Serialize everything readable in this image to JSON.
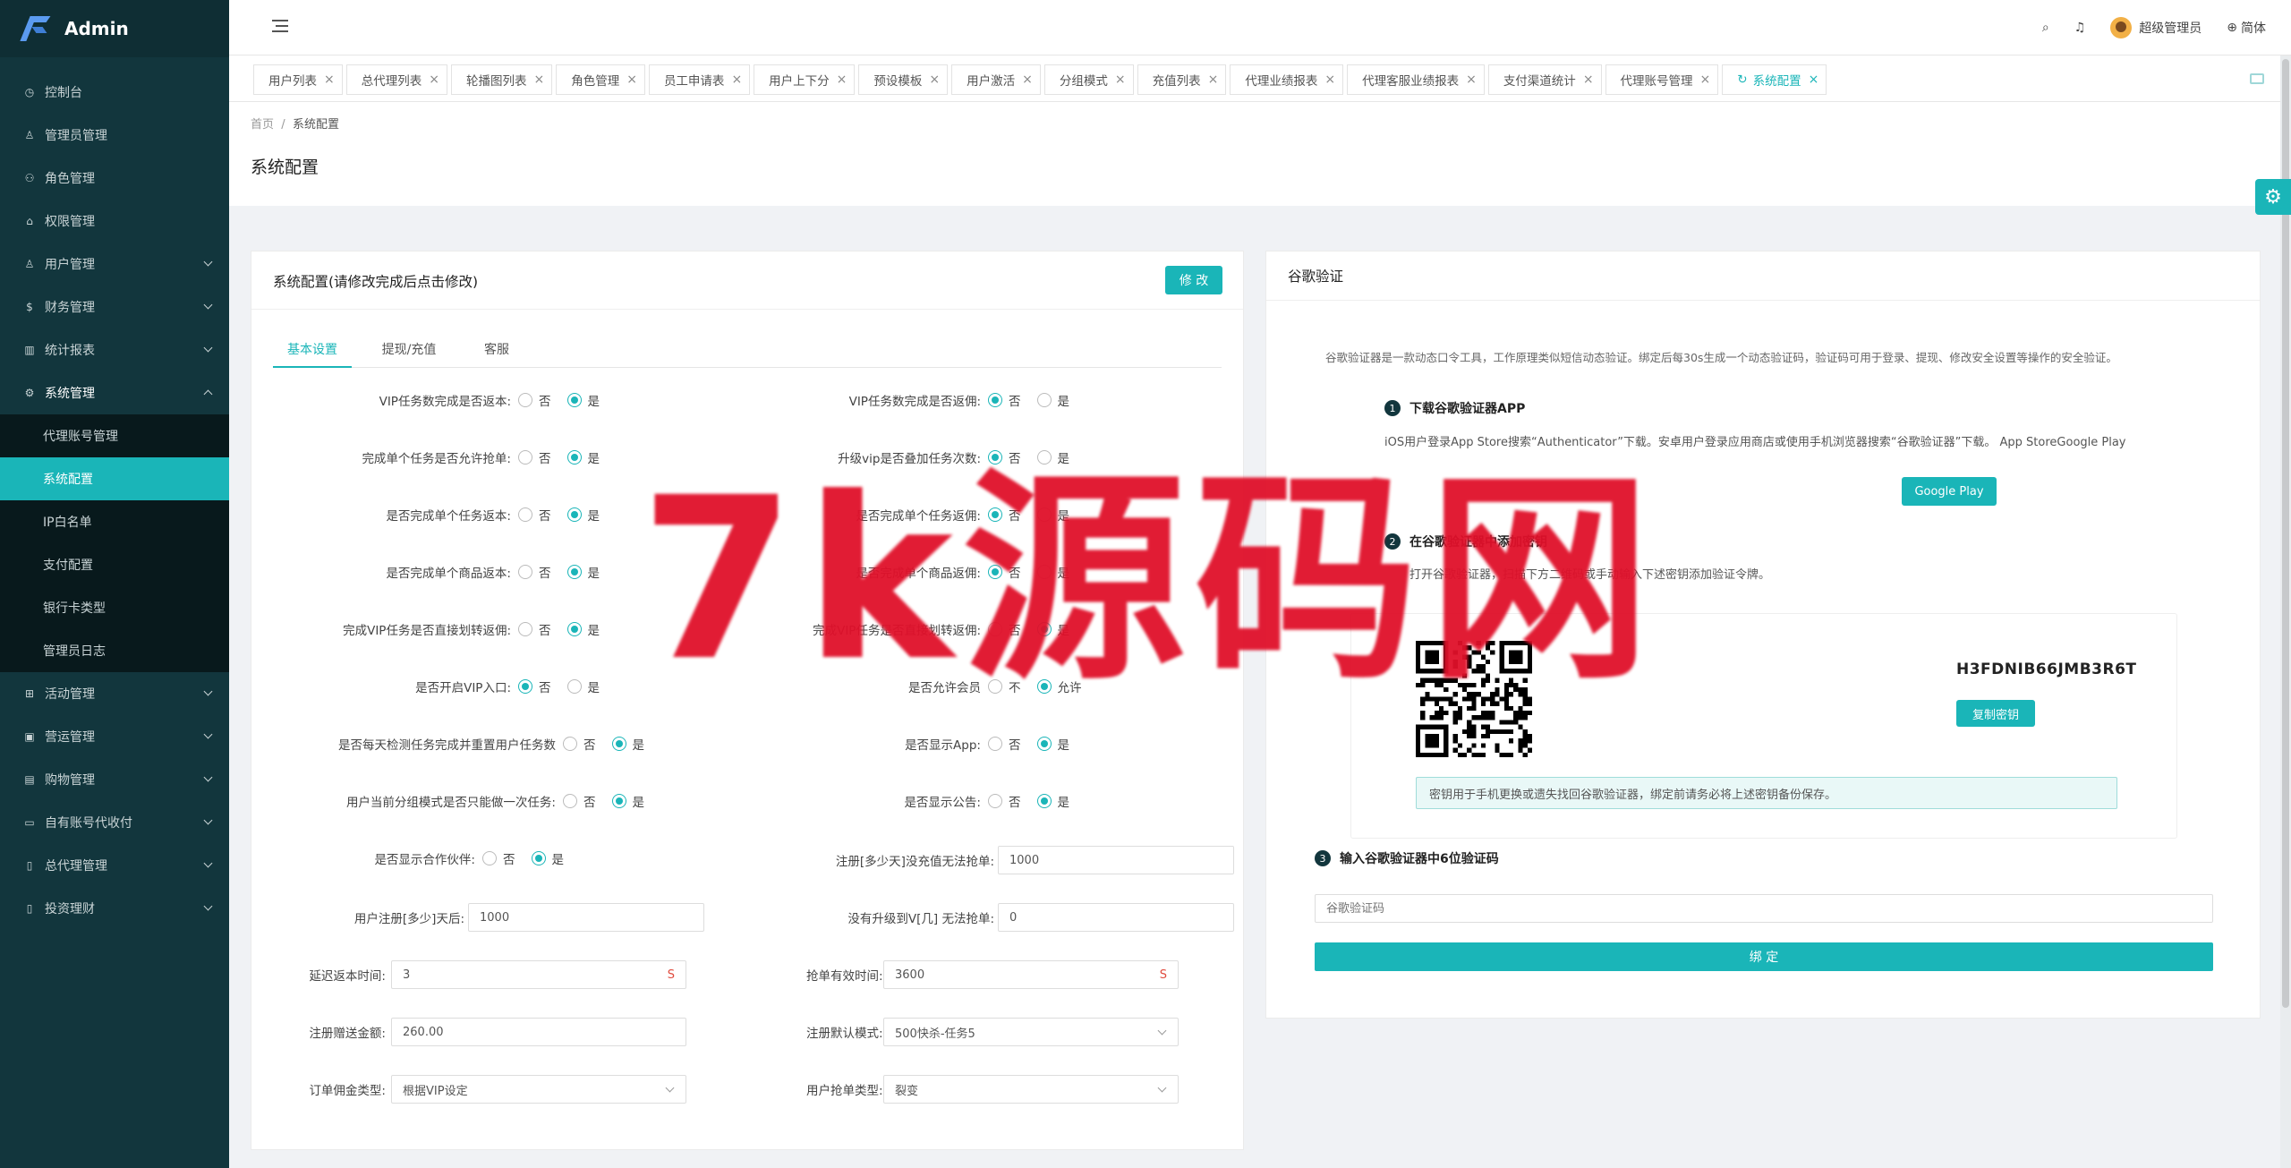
{
  "app": {
    "title": "Admin",
    "accent": "#1ab5b8",
    "sidebar_bg": "#12363d"
  },
  "sidebar": {
    "items": [
      {
        "label": "控制台",
        "icon": "clock-icon"
      },
      {
        "label": "管理员管理",
        "icon": "user-icon"
      },
      {
        "label": "角色管理",
        "icon": "users-icon"
      },
      {
        "label": "权限管理",
        "icon": "bank-icon"
      },
      {
        "label": "用户管理",
        "icon": "user-icon"
      },
      {
        "label": "财务管理",
        "icon": "money-icon"
      },
      {
        "label": "统计报表",
        "icon": "chart-icon"
      },
      {
        "label": "系统管理",
        "icon": "gear-icon"
      },
      {
        "label": "活动管理",
        "icon": "gift-icon"
      },
      {
        "label": "营运管理",
        "icon": "briefcase-icon"
      },
      {
        "label": "购物管理",
        "icon": "cart-icon"
      },
      {
        "label": "自有账号代收付",
        "icon": "card-icon"
      },
      {
        "label": "总代理管理",
        "icon": "doc-icon"
      },
      {
        "label": "投资理财",
        "icon": "doc-icon"
      }
    ],
    "system_sub": [
      "代理账号管理",
      "系统配置",
      "IP白名单",
      "支付配置",
      "银行卡类型",
      "管理员日志"
    ]
  },
  "topbar": {
    "user": "超级管理员",
    "lang": "简体"
  },
  "tabs": [
    "用户列表",
    "总代理列表",
    "轮播图列表",
    "角色管理",
    "员工申请表",
    "用户上下分",
    "预设模板",
    "用户激活",
    "分组模式",
    "充值列表",
    "代理业绩报表",
    "代理客服业绩报表",
    "支付渠道统计",
    "代理账号管理",
    "系统配置"
  ],
  "page": {
    "breadcrumb_home": "首页",
    "breadcrumb_sep": "/",
    "breadcrumb_current": "系统配置",
    "title": "系统配置"
  },
  "config": {
    "title": "系统配置(请修改完成后点击修改)",
    "edit": "修 改",
    "tabs": [
      "基本设置",
      "提现/充值",
      "客服"
    ],
    "no": "否",
    "yes": "是",
    "rows": [
      {
        "label": "VIP任务数完成是否返本:",
        "on": "yes"
      },
      {
        "label": "VIP任务数完成是否返佣:",
        "on": "no"
      },
      {
        "label": "完成单个任务是否允许抢单:",
        "on": "yes"
      },
      {
        "label": "升级vip是否叠加任务次数:",
        "on": "no"
      },
      {
        "label": "是否完成单个任务返本:",
        "on": "yes"
      },
      {
        "label": "是否完成单个任务返佣:",
        "on": "no"
      },
      {
        "label": "是否完成单个商品返本:",
        "on": "yes"
      },
      {
        "label": "是否完成单个商品返佣:",
        "on": "no"
      },
      {
        "label": "完成VIP任务是否直接划转返佣:",
        "on": "yes"
      },
      {
        "label": "完成VIP任务是否直接划转返佣:",
        "on": "yes"
      },
      {
        "label": "是否开启VIP入口:",
        "on": "no"
      },
      {
        "label": "是否允许会员",
        "on": "yes",
        "no_alt": "不",
        "yes_alt": "允许"
      },
      {
        "label": "是否每天检测任务完成并重置用户任务数",
        "on": "yes"
      },
      {
        "label": "是否显示App:",
        "on": "yes"
      },
      {
        "label": "用户当前分组模式是否只能做一次任务:",
        "on": "yes"
      },
      {
        "label": "是否显示公告:",
        "on": "yes"
      },
      {
        "label": "是否显示合作伙伴:",
        "on": "yes"
      }
    ],
    "register_days_label": "注册[多少天]没充值无法抢单:",
    "register_days": "1000",
    "user_register_label": "用户注册[多少]天后:",
    "user_register": "1000",
    "no_upgrade_label": "没有升级到V[几] 无法抢单:",
    "no_upgrade": "0",
    "delay_label": "延迟返本时间:",
    "delay": "3",
    "delay_suffix": "S",
    "grab_label": "抢单有效时间:",
    "grab": "3600",
    "grab_suffix": "S",
    "gift_label": "注册赠送金额:",
    "gift": "260.00",
    "default_mode_label": "注册默认模式:",
    "default_mode": "500快杀-任务5",
    "commission_label": "订单佣金类型:",
    "commission": "根据VIP设定",
    "grab_type_label": "用户抢单类型:",
    "grab_type": "裂变"
  },
  "google": {
    "title": "谷歌验证",
    "desc": "谷歌验证器是一款动态口令工具，工作原理类似短信动态验证。绑定后每30s生成一个动态验证码，验证码可用于登录、提现、修改安全设置等操作的安全验证。",
    "step1": "下载谷歌验证器APP",
    "step1_text": "iOS用户登录App Store搜索“Authenticator”下载。安卓用户登录应用商店或使用手机浏览器搜索“谷歌验证器”下载。 App StoreGoogle Play",
    "google_play": "Google Play",
    "step2": "在谷歌验证器中添加密钥",
    "step2_text": "打开谷歌验证器，扫描下方二维码或手动输入下述密钥添加验证令牌。",
    "secret": "H3FDNIB66JMB3R6T",
    "copy": "复制密钥",
    "tip": "密钥用于手机更换或遗失找回谷歌验证器，绑定前请务必将上述密钥备份保存。",
    "step3": "输入谷歌验证器中6位验证码",
    "placeholder": "谷歌验证码",
    "bind": "绑 定"
  },
  "watermark": "7k源码网"
}
